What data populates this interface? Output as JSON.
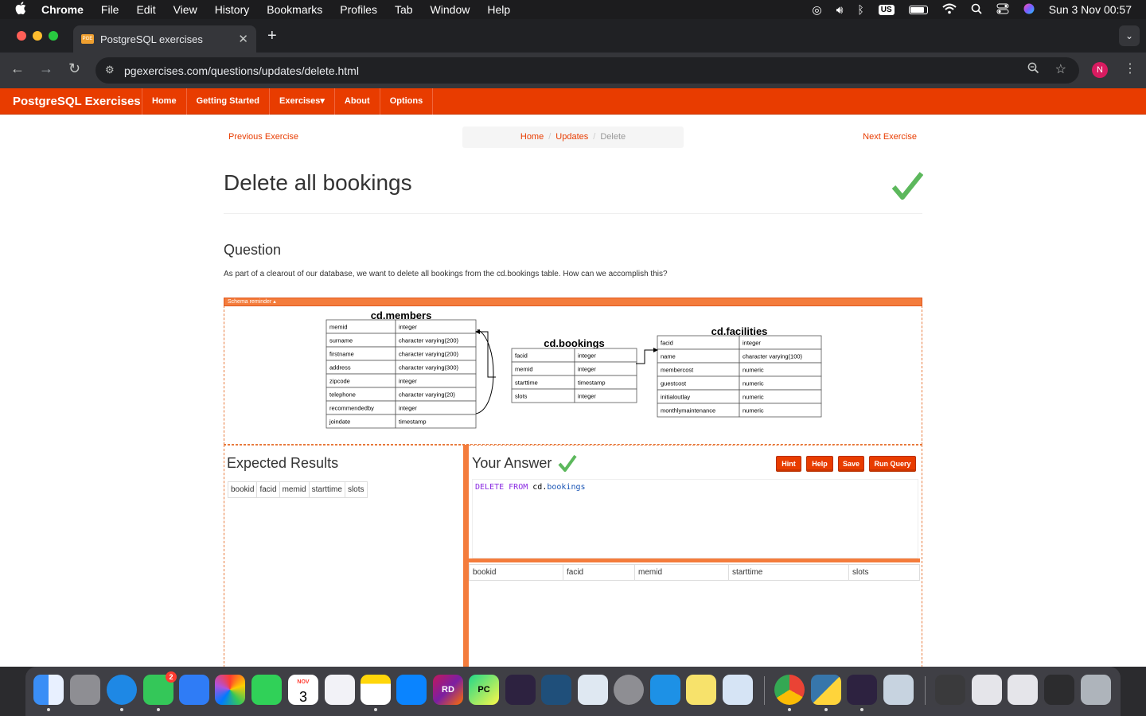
{
  "menubar": {
    "app": "Chrome",
    "items": [
      "File",
      "Edit",
      "View",
      "History",
      "Bookmarks",
      "Profiles",
      "Tab",
      "Window",
      "Help"
    ],
    "input_source": "US",
    "datetime": "Sun 3 Nov  00:57"
  },
  "browser": {
    "tab_title": "PostgreSQL exercises",
    "favicon_text": "PGE",
    "url": "pgexercises.com/questions/updates/delete.html",
    "profile_initial": "N"
  },
  "site": {
    "brand": "PostgreSQL Exercises",
    "nav": [
      "Home",
      "Getting Started",
      "Exercises▾",
      "About",
      "Options"
    ],
    "prev_label": "Previous Exercise",
    "next_label": "Next Exercise",
    "breadcrumb": {
      "home": "Home",
      "section": "Updates",
      "current": "Delete",
      "sep": "/"
    },
    "title": "Delete all bookings",
    "question_heading": "Question",
    "question_text": "As part of a clearout of our database, we want to delete all bookings from the cd.bookings table. How can we accomplish this?",
    "schema_bar": "Schema reminder ▴",
    "expected_heading": "Expected Results",
    "answer_heading": "Your Answer",
    "buttons": {
      "hint": "Hint",
      "help": "Help",
      "save": "Save",
      "run": "Run Query"
    },
    "query": {
      "kw1": "DELETE",
      "kw2": "FROM",
      "schema": "cd.",
      "table": "bookings"
    },
    "expected_columns": [
      "bookid",
      "facid",
      "memid",
      "starttime",
      "slots"
    ],
    "answer_columns": [
      "bookid",
      "facid",
      "memid",
      "starttime",
      "slots"
    ]
  },
  "schema": {
    "members": {
      "title": "cd.members",
      "rows": [
        [
          "memid",
          "integer"
        ],
        [
          "surname",
          "character varying(200)"
        ],
        [
          "firstname",
          "character varying(200)"
        ],
        [
          "address",
          "character varying(300)"
        ],
        [
          "zipcode",
          "integer"
        ],
        [
          "telephone",
          "character varying(20)"
        ],
        [
          "recommendedby",
          "integer"
        ],
        [
          "joindate",
          "timestamp"
        ]
      ]
    },
    "bookings": {
      "title": "cd.bookings",
      "rows": [
        [
          "facid",
          "integer"
        ],
        [
          "memid",
          "integer"
        ],
        [
          "starttime",
          "timestamp"
        ],
        [
          "slots",
          "integer"
        ]
      ]
    },
    "facilities": {
      "title": "cd.facilities",
      "rows": [
        [
          "facid",
          "integer"
        ],
        [
          "name",
          "character varying(100)"
        ],
        [
          "membercost",
          "numeric"
        ],
        [
          "guestcost",
          "numeric"
        ],
        [
          "initialoutlay",
          "numeric"
        ],
        [
          "monthlymaintenance",
          "numeric"
        ]
      ]
    }
  },
  "dock": {
    "messages_badge": "2",
    "calendar_month": "NOV",
    "calendar_day": "3",
    "rider_label": "RD",
    "pycharm_label": "PC"
  },
  "colors": {
    "accent": "#e83c00",
    "schema_bar": "#f47c3c",
    "check": "#5cb85c"
  }
}
